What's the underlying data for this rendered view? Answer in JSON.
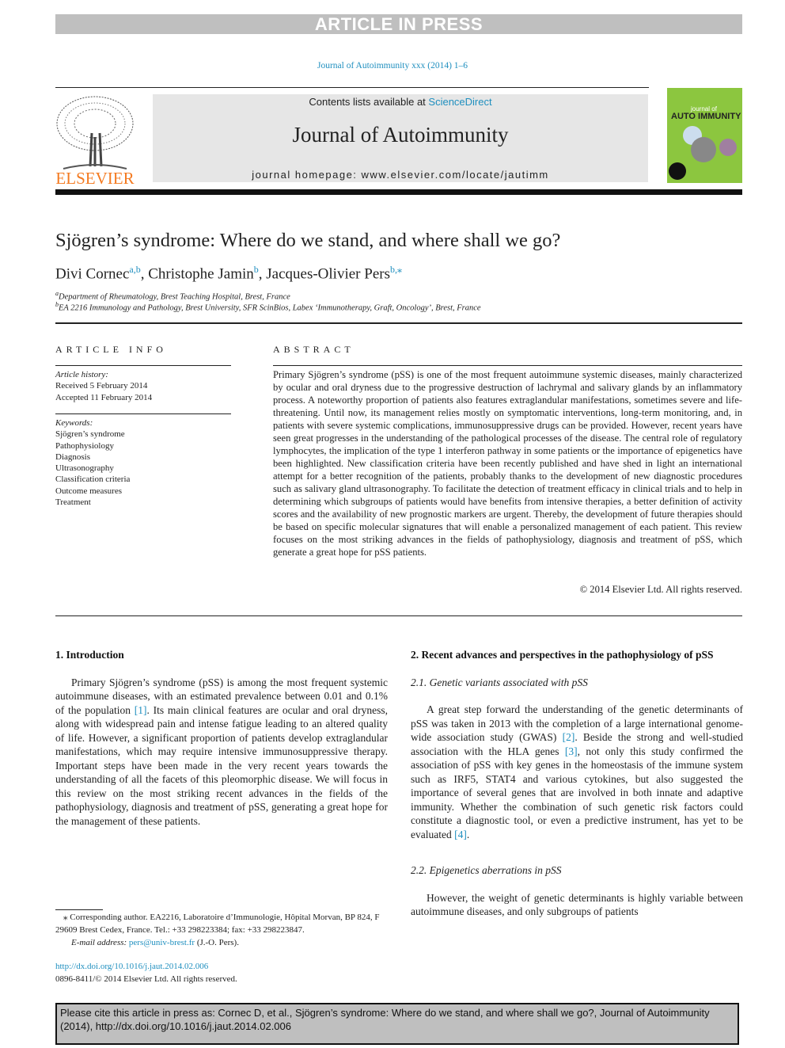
{
  "banner": {
    "article_in_press": "ARTICLE IN PRESS"
  },
  "journal_ref": "Journal of Autoimmunity xxx (2014) 1–6",
  "header": {
    "publisher_logo_text": "ELSEVIER",
    "contents_prefix": "Contents lists available at ",
    "contents_link": "ScienceDirect",
    "journal_title": "Journal of Autoimmunity",
    "homepage": "journal homepage: www.elsevier.com/locate/jautimm",
    "cover": {
      "line1": "journal of",
      "line2": "AUTO IMMUNITY"
    }
  },
  "article": {
    "title": "Sjögren’s syndrome: Where do we stand, and where shall we go?",
    "authors": [
      {
        "name": "Divi Cornec",
        "sup": "a,b"
      },
      {
        "name": "Christophe Jamin",
        "sup": "b"
      },
      {
        "name": "Jacques-Olivier Pers",
        "sup": "b,⁎"
      }
    ],
    "affiliations": [
      {
        "mark": "a",
        "text": "Department of Rheumatology, Brest Teaching Hospital, Brest, France"
      },
      {
        "mark": "b",
        "text": "EA 2216 Immunology and Pathology, Brest University, SFR ScinBios, Labex ‘Immunotherapy, Graft, Oncology’, Brest, France"
      }
    ]
  },
  "article_info": {
    "heading": "ARTICLE INFO",
    "history_label": "Article history:",
    "received": "Received 5 February 2014",
    "accepted": "Accepted 11 February 2014",
    "keywords_label": "Keywords:",
    "keywords": [
      "Sjögren’s syndrome",
      "Pathophysiology",
      "Diagnosis",
      "Ultrasonography",
      "Classification criteria",
      "Outcome measures",
      "Treatment"
    ]
  },
  "abstract": {
    "heading": "ABSTRACT",
    "text": "Primary Sjögren’s syndrome (pSS) is one of the most frequent autoimmune systemic diseases, mainly characterized by ocular and oral dryness due to the progressive destruction of lachrymal and salivary glands by an inflammatory process. A noteworthy proportion of patients also features extraglandular manifestations, sometimes severe and life-threatening. Until now, its management relies mostly on symptomatic interventions, long-term monitoring, and, in patients with severe systemic complications, immunosuppressive drugs can be provided. However, recent years have seen great progresses in the understanding of the pathological processes of the disease. The central role of regulatory lymphocytes, the implication of the type 1 interferon pathway in some patients or the importance of epigenetics have been highlighted. New classification criteria have been recently published and have shed in light an international attempt for a better recognition of the patients, probably thanks to the development of new diagnostic procedures such as salivary gland ultrasonography. To facilitate the detection of treatment efficacy in clinical trials and to help in determining which subgroups of patients would have benefits from intensive therapies, a better definition of activity scores and the availability of new prognostic markers are urgent. Thereby, the development of future therapies should be based on specific molecular signatures that will enable a personalized management of each patient. This review focuses on the most striking advances in the fields of pathophysiology, diagnosis and treatment of pSS, which generate a great hope for pSS patients.",
    "copyright": "© 2014 Elsevier Ltd. All rights reserved."
  },
  "body": {
    "intro_heading": "1.  Introduction",
    "intro_p1": "Primary Sjögren’s syndrome (pSS) is among the most frequent systemic autoimmune diseases, with an estimated prevalence between 0.01 and 0.1% of the population ",
    "intro_ref1": "[1]",
    "intro_p2": ". Its main clinical features are ocular and oral dryness, along with widespread pain and intense fatigue leading to an altered quality of life. However, a significant proportion of patients develop extraglandular manifestations, which may require intensive immunosuppressive therapy. Important steps have been made in the very recent years towards the understanding of all the facets of this pleomorphic disease. We will focus in this review on the most striking recent advances in the fields of the pathophysiology, diagnosis and treatment of pSS, generating a great hope for the management of these patients.",
    "sec2_heading": "2.  Recent advances and perspectives in the pathophysiology of pSS",
    "sec21_heading": "2.1.  Genetic variants associated with pSS",
    "sec21_a": "A great step forward the understanding of the genetic determinants of pSS was taken in 2013 with the completion of a large international genome-wide association study (GWAS) ",
    "sec21_ref2": "[2]",
    "sec21_b": ". Beside the strong and well-studied association with the HLA genes ",
    "sec21_ref3": "[3]",
    "sec21_c": ", not only this study confirmed the association of pSS with key genes in the homeostasis of the immune system such as IRF5, STAT4 and various cytokines, but also suggested the importance of several genes that are involved in both innate and adaptive immunity. Whether the combination of such genetic risk factors could constitute a diagnostic tool, or even a predictive instrument, has yet to be evaluated ",
    "sec21_ref4": "[4]",
    "sec21_d": ".",
    "sec22_heading": "2.2.  Epigenetics aberrations in pSS",
    "sec22_p": "However, the weight of genetic determinants is highly variable between autoimmune diseases, and only subgroups of patients"
  },
  "footnote": {
    "corresponding": "⁎ Corresponding author. EA2216, Laboratoire d’Immunologie, Hôpital Morvan, BP 824, F 29609 Brest Cedex, France. Tel.: +33 298223384; fax: +33 298223847.",
    "email_label": "E-mail address: ",
    "email": "pers@univ-brest.fr",
    "email_suffix": " (J.-O. Pers).",
    "doi": "http://dx.doi.org/10.1016/j.jaut.2014.02.006",
    "issn": "0896-8411/© 2014 Elsevier Ltd. All rights reserved."
  },
  "cite_box": "Please cite this article in press as: Cornec D, et al., Sjögren’s syndrome: Where do we stand, and where shall we go?, Journal of Autoimmunity (2014), http://dx.doi.org/10.1016/j.jaut.2014.02.006"
}
